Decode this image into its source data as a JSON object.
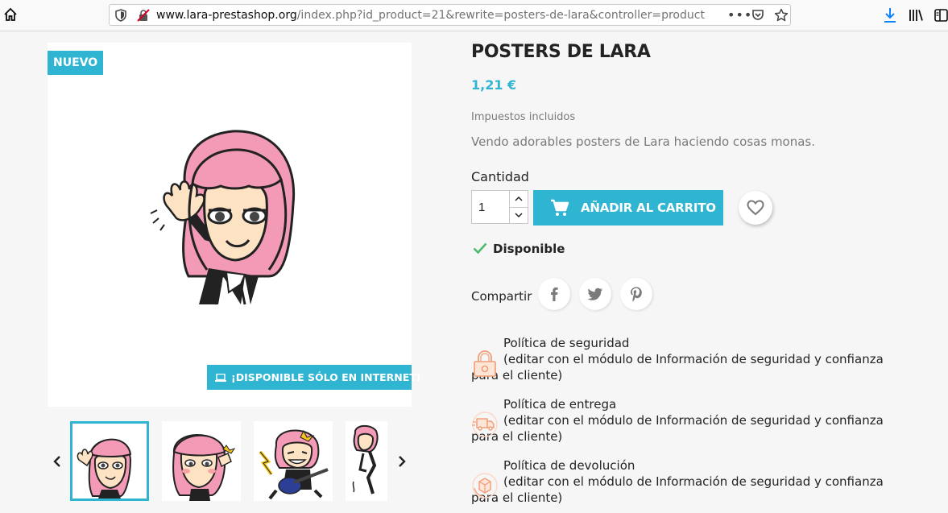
{
  "browser": {
    "url_host": "www.lara-prestashop.org",
    "url_path": "/index.php?id_product=21&rewrite=posters-de-lara&controller=product",
    "more_label": "•••"
  },
  "product": {
    "badge": "NUEVO",
    "online_only": "¡DISPONIBLE SÓLO EN INTERNET!",
    "title": "POSTERS DE LARA",
    "price": "1,21 €",
    "tax_label": "Impuestos incluidos",
    "description": "Vendo adorables posters de Lara haciendo cosas monas.",
    "quantity_label": "Cantidad",
    "quantity_value": "1",
    "add_to_cart": "AÑADIR AL CARRITO",
    "availability": "Disponible",
    "share_label": "Compartir"
  },
  "gallery": {
    "thumbnail_count": 4,
    "selected_index": 0
  },
  "reassurance": [
    {
      "title": "Política de seguridad",
      "text": "(editar con el módulo de Información de seguridad y confianza para el cliente)",
      "icon": "lock-icon"
    },
    {
      "title": "Política de entrega",
      "text": "(editar con el módulo de Información de seguridad y confianza para el cliente)",
      "icon": "delivery-truck-icon"
    },
    {
      "title": "Política de devolución",
      "text": "(editar con el módulo de Información de seguridad y confianza para el cliente)",
      "icon": "return-box-icon"
    }
  ],
  "colors": {
    "accent": "#2fb5d2",
    "available": "#4cbb6c",
    "reassurance_icon": "#f19d76"
  }
}
